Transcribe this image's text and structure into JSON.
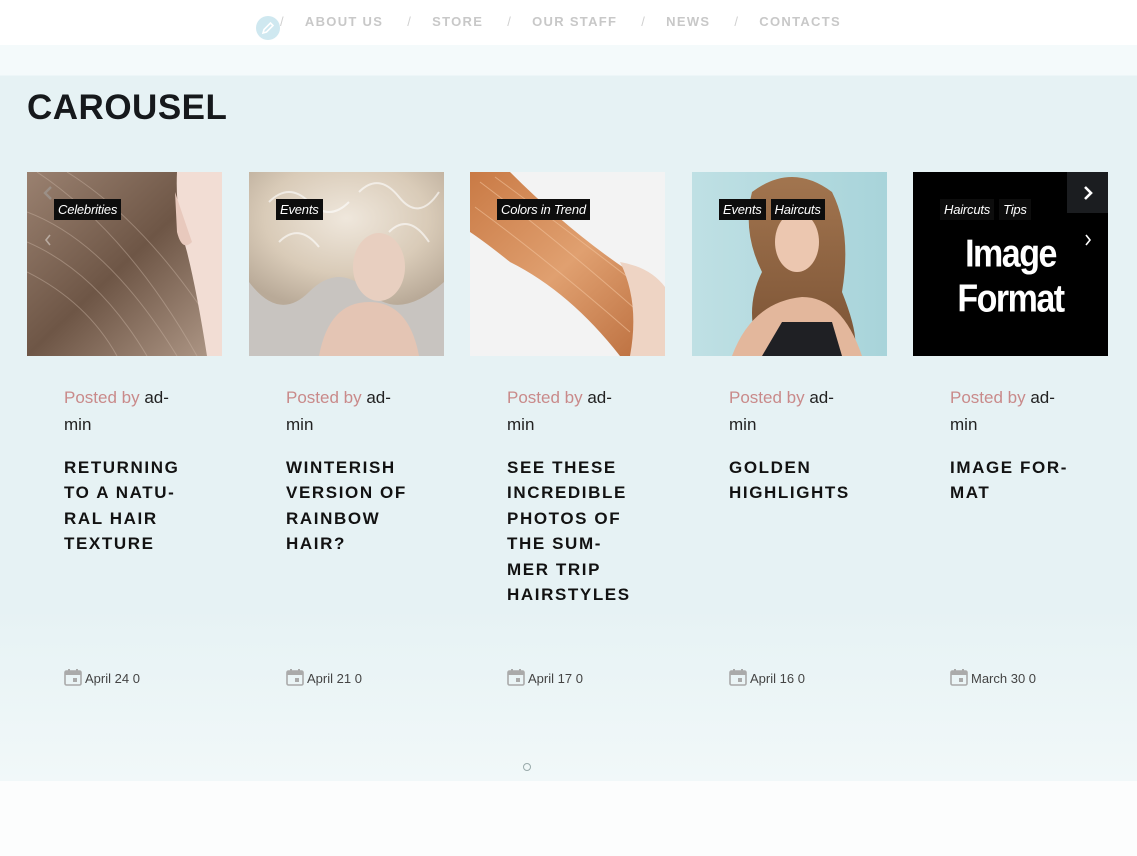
{
  "nav": {
    "items": [
      "ABOUT US",
      "STORE",
      "OUR STAFF",
      "NEWS",
      "CONTACTS"
    ],
    "separator": "/"
  },
  "section_title": "CAROUSEL",
  "posted_by_label": "Posted by",
  "author_part1": "ad-",
  "author_part2": "min",
  "posts": [
    {
      "tags": [
        "Celebrities"
      ],
      "title": "RETURNING TO A NATU-RAL HAIR TEXTURE",
      "title_lines": [
        "RETURNING",
        "TO A NATU-",
        "RAL HAIR",
        "TEXTURE"
      ],
      "date": "April 24 0"
    },
    {
      "tags": [
        "Events"
      ],
      "title_lines": [
        "WINTERISH",
        "VERSION OF",
        "RAINBOW",
        "HAIR?"
      ],
      "date": "April 21 0"
    },
    {
      "tags": [
        "Colors in Trend"
      ],
      "title_lines": [
        "SEE THESE",
        "INCREDIBLE",
        "PHOTOS OF",
        "THE SUM-",
        "MER TRIP",
        "HAIRSTYLES"
      ],
      "date": "April 17 0"
    },
    {
      "tags": [
        "Events",
        "Haircuts"
      ],
      "title_lines": [
        "GOLDEN",
        "HIGHLIGHTS"
      ],
      "date": "April 16 0"
    },
    {
      "tags": [
        "Haircuts",
        "Tips"
      ],
      "title_lines": [
        "IMAGE FOR-",
        "MAT"
      ],
      "date": "March 30 0",
      "image_text": "Image Format"
    }
  ],
  "colors": {
    "posted_by": "#c98a8a",
    "section_bg": "#e6f2f4",
    "tag_bg": "#0d0d0d"
  }
}
